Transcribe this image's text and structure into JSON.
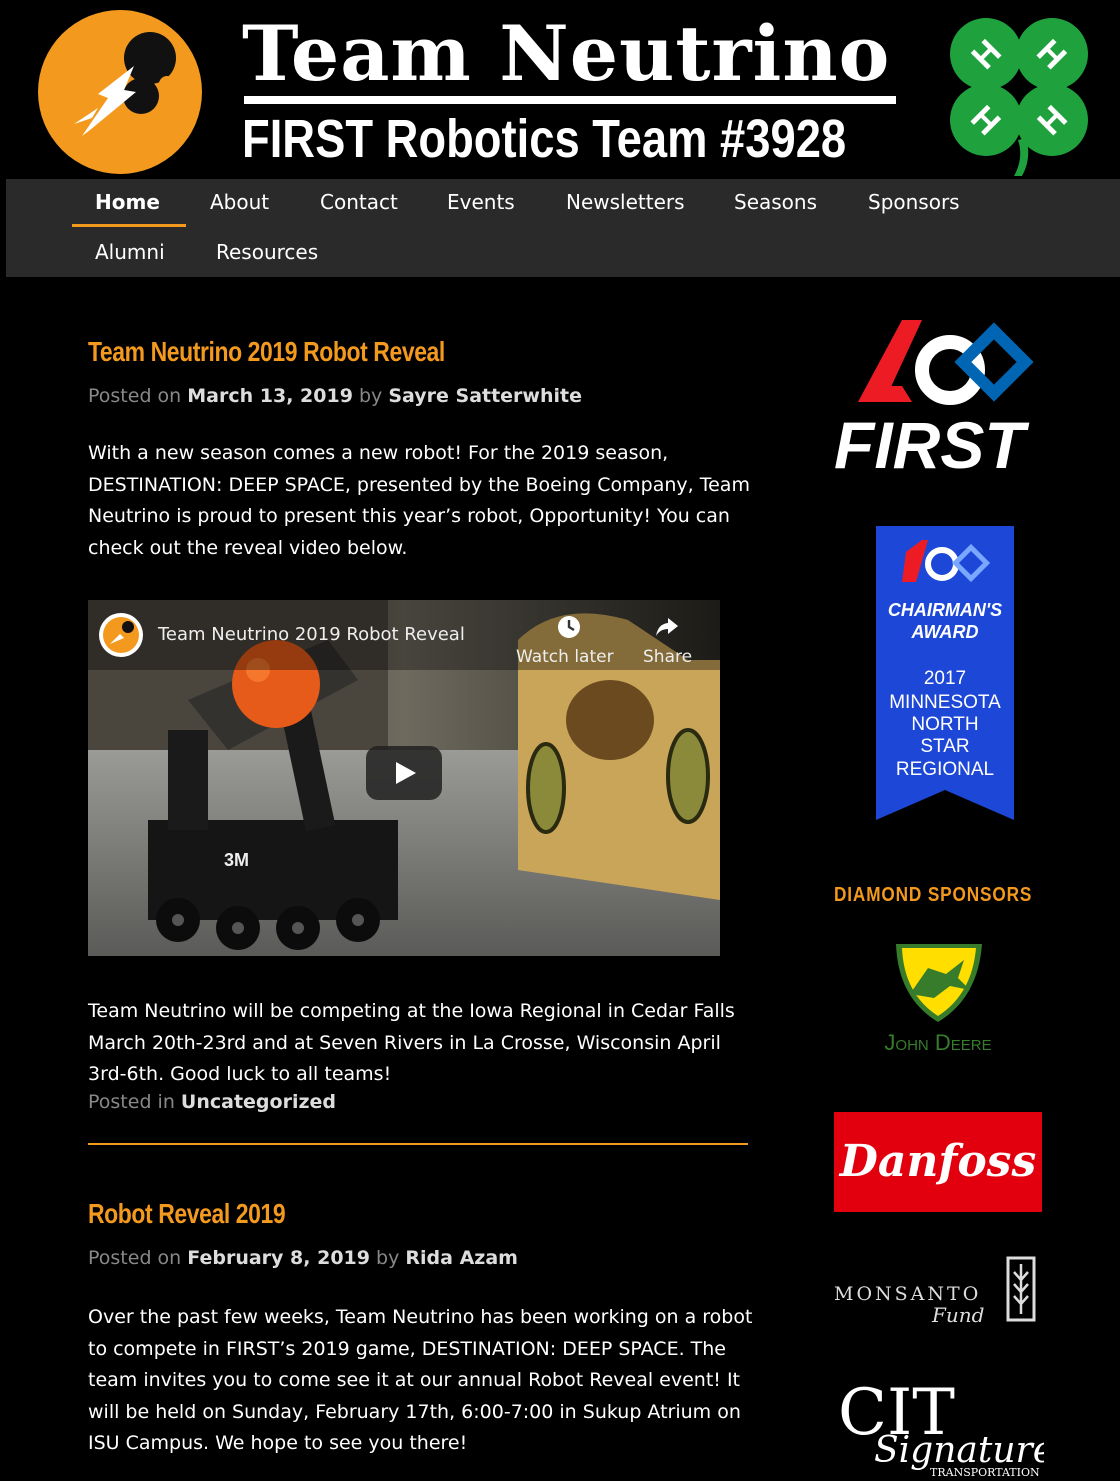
{
  "header": {
    "title": "Team Neutrino",
    "subtitle": "FIRST Robotics Team #3928"
  },
  "nav": {
    "items": [
      {
        "label": "Home",
        "active": true
      },
      {
        "label": "About"
      },
      {
        "label": "Contact"
      },
      {
        "label": "Events"
      },
      {
        "label": "Newsletters"
      },
      {
        "label": "Seasons"
      },
      {
        "label": "Sponsors"
      },
      {
        "label": "Alumni"
      },
      {
        "label": "Resources"
      }
    ]
  },
  "posts": [
    {
      "title": "Team Neutrino 2019 Robot Reveal",
      "posted_on_label": "Posted on",
      "date": "March 13, 2019",
      "by_label": "by",
      "author": "Sayre Satterwhite",
      "paragraphs": [
        "With a new season comes a new robot! For the 2019 season, DESTINATION: DEEP SPACE, presented by the Boeing Company, Team Neutrino is proud to present this year’s robot, Opportunity! You can check out the reveal video below.",
        "Team Neutrino will be competing at the Iowa Regional in Cedar Falls March 20th-23rd and at Seven Rivers in La Crosse, Wisconsin April 3rd-6th. Good luck to all teams!"
      ],
      "posted_in_label": "Posted in",
      "category": "Uncategorized",
      "video": {
        "title": "Team Neutrino 2019 Robot Reveal",
        "watch_later": "Watch later",
        "share": "Share",
        "robot_label_3m": "3M"
      }
    },
    {
      "title": "Robot Reveal 2019",
      "posted_on_label": "Posted on",
      "date": "February 8, 2019",
      "by_label": "by",
      "author": "Rida Azam",
      "paragraphs": [
        "Over the past few weeks, Team Neutrino has been working on a robot to compete in FIRST’s 2019 game, DESTINATION: DEEP SPACE. The team invites you to come see it at our annual Robot Reveal event! It will be held on Sunday, February 17th, 6:00-7:00 in Sukup Atrium on ISU Campus. We hope to see you there!"
      ]
    }
  ],
  "sidebar": {
    "first_logo_text": "FIRST",
    "award": {
      "line1": "CHAIRMAN'S",
      "line2": "AWARD",
      "year": "2017",
      "l1": "MINNESOTA",
      "l2": "NORTH",
      "l3": "STAR",
      "l4": "REGIONAL"
    },
    "diamond_heading": "DIAMOND SPONSORS",
    "sponsors": {
      "john_deere": "John Deere",
      "danfoss": "Danfoss",
      "monsanto": "MONSANTO",
      "monsanto_fund": "Fund",
      "cit": "CIT",
      "signature": "Signature",
      "transportation": "TRANSPORTATION"
    }
  },
  "colors": {
    "accent": "#f39a1e",
    "nav_bg": "#2a2a2a",
    "award_blue": "#1d47d6",
    "deere_green": "#367c2b",
    "deere_yellow": "#ffde00",
    "danfoss_red": "#e2000f",
    "clover_green": "#1fa23e"
  }
}
